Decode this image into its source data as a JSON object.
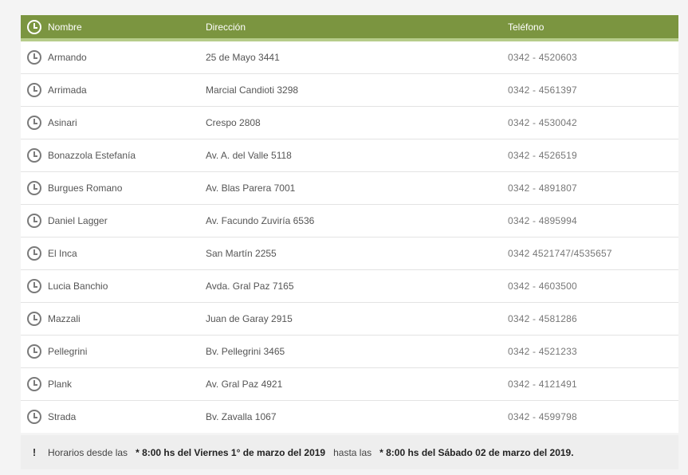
{
  "header": {
    "name": "Nombre",
    "address": "Dirección",
    "phone": "Teléfono"
  },
  "rows": [
    {
      "name": "Armando",
      "address": "25 de Mayo 3441",
      "phone": "0342 - 4520603"
    },
    {
      "name": "Arrimada",
      "address": "Marcial Candioti 3298",
      "phone": "0342 - 4561397"
    },
    {
      "name": "Asinari",
      "address": "Crespo 2808",
      "phone": "0342 - 4530042"
    },
    {
      "name": "Bonazzola Estefanía",
      "address": "Av. A. del Valle 5118",
      "phone": "0342 - 4526519"
    },
    {
      "name": "Burgues Romano",
      "address": "Av. Blas Parera 7001",
      "phone": "0342 - 4891807"
    },
    {
      "name": "Daniel Lagger",
      "address": "Av. Facundo Zuviría 6536",
      "phone": "0342 - 4895994"
    },
    {
      "name": "El Inca",
      "address": "San Martín 2255",
      "phone": "0342 4521747/4535657"
    },
    {
      "name": "Lucia Banchio",
      "address": "Avda. Gral Paz 7165",
      "phone": "0342 - 4603500"
    },
    {
      "name": "Mazzali",
      "address": "Juan de Garay 2915",
      "phone": "0342 - 4581286"
    },
    {
      "name": "Pellegrini",
      "address": "Bv. Pellegrini 3465",
      "phone": "0342 - 4521233"
    },
    {
      "name": "Plank",
      "address": "Av. Gral Paz 4921",
      "phone": "0342 - 4121491"
    },
    {
      "name": "Strada",
      "address": "Bv. Zavalla 1067",
      "phone": "0342 - 4599798"
    }
  ],
  "footer": {
    "mark": "!",
    "from_label": "Horarios desde las",
    "from_value": "* 8:00 hs del Viernes 1° de marzo del 2019",
    "to_label": "hasta las",
    "to_value": "* 8:00 hs del Sábado 02 de marzo del 2019."
  },
  "icons": {
    "header": "clock-icon",
    "row": "clock-icon"
  },
  "colors": {
    "header_bg": "#7b9540",
    "header_stripe": "#b6cc8a",
    "footer_bg": "#eeeeee"
  }
}
